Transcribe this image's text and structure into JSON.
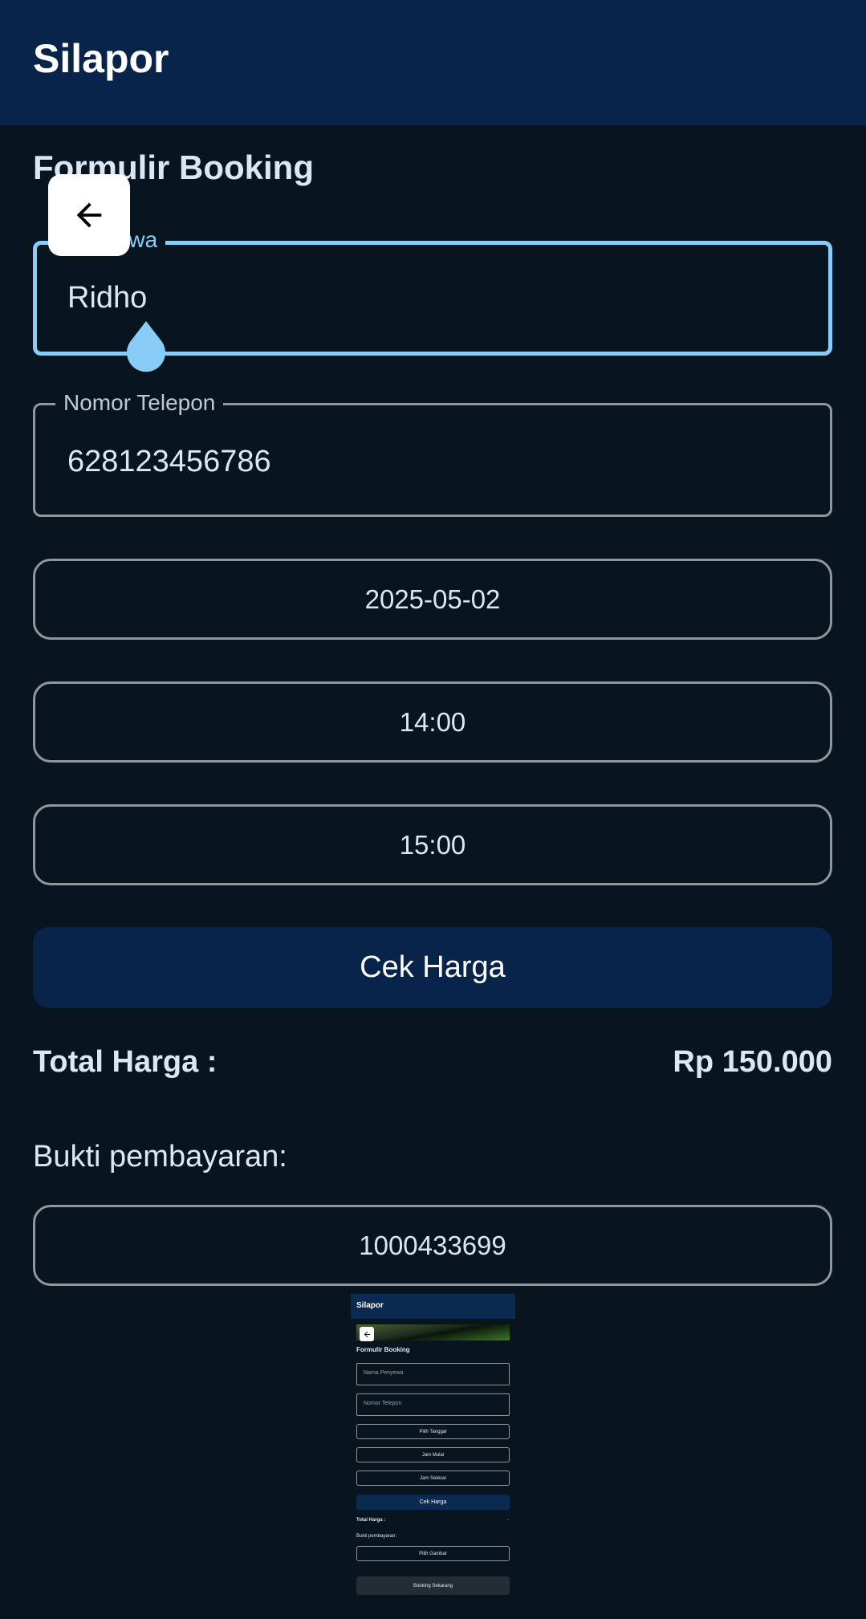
{
  "app": {
    "title": "Silapor"
  },
  "form": {
    "title": "Formulir Booking",
    "name_field": {
      "label": "Penyewa",
      "value": "Ridho"
    },
    "phone_field": {
      "label": "Nomor Telepon",
      "value": "628123456786"
    },
    "date_value": "2025-05-02",
    "start_time_value": "14:00",
    "end_time_value": "15:00",
    "check_price_label": "Cek Harga",
    "total_label": "Total Harga :",
    "total_value": "Rp 150.000",
    "payment_label": "Bukti pembayaran:",
    "payment_file_value": "1000433699"
  },
  "preview": {
    "app_title": "Silapor",
    "form_title": "Formulir Booking",
    "name_placeholder": "Nama Penyewa",
    "phone_placeholder": "Nomor Telepon",
    "date_label": "Pilih Tanggal",
    "start_label": "Jam Mulai",
    "end_label": "Jam Selesai",
    "check_price_label": "Cek Harga",
    "total_label": "Total Harga :",
    "total_value": "-",
    "payment_label": "Bukti pembayaran:",
    "pick_image_label": "Pilih Gambar",
    "booking_label": "Booking Sekarang"
  },
  "colors": {
    "background": "#08151e",
    "appbar": "#08244a",
    "focus_accent": "#88cdf8",
    "outline": "#8f969c"
  }
}
